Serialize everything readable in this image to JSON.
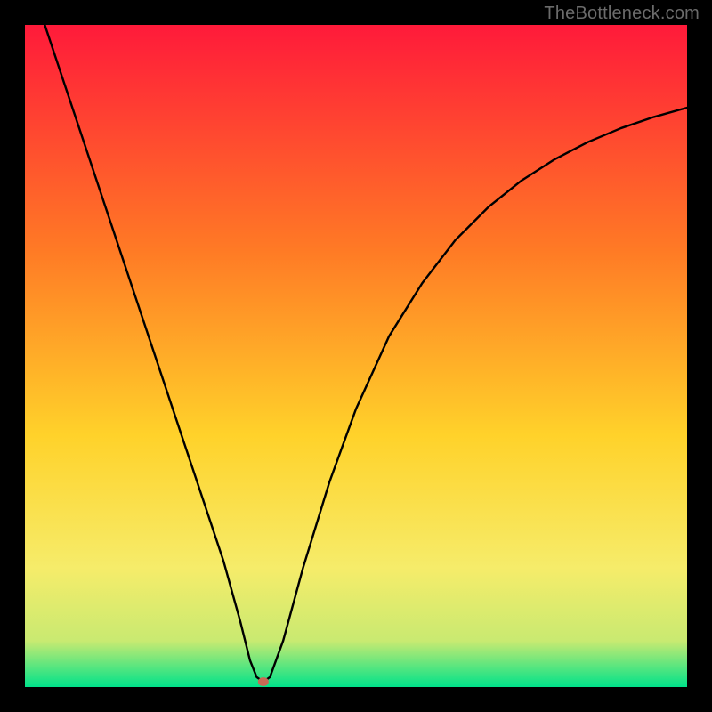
{
  "watermark": "TheBottleneck.com",
  "chart_data": {
    "type": "line",
    "title": "",
    "xlabel": "",
    "ylabel": "",
    "xlim": [
      0,
      100
    ],
    "ylim": [
      0,
      100
    ],
    "grid": false,
    "legend": false,
    "background_gradient": {
      "top": "#ff1a3a",
      "mid_upper": "#ff7a25",
      "mid": "#ffd22a",
      "mid_lower": "#f6ec6a",
      "near_bottom": "#c9ea71",
      "bottom": "#00e28a"
    },
    "series": [
      {
        "name": "bottleneck-curve",
        "color": "#000000",
        "x": [
          3,
          6,
          9,
          12,
          15,
          18,
          21,
          24,
          27,
          30,
          32.5,
          34,
          35,
          36,
          37,
          39,
          42,
          46,
          50,
          55,
          60,
          65,
          70,
          75,
          80,
          85,
          90,
          95,
          100
        ],
        "y": [
          100,
          91,
          82,
          73,
          64,
          55,
          46,
          37,
          28,
          19,
          10,
          4,
          1.5,
          0.8,
          1.5,
          7,
          18,
          31,
          42,
          53,
          61,
          67.5,
          72.5,
          76.5,
          79.7,
          82.3,
          84.4,
          86.1,
          87.5
        ]
      }
    ],
    "marker": {
      "name": "minimum-marker",
      "x": 36,
      "y": 0.8,
      "color": "#c86a55",
      "rx": 6,
      "ry": 5
    }
  }
}
